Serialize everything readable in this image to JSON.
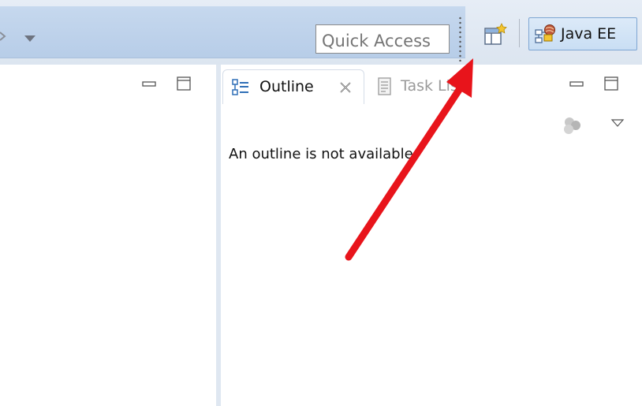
{
  "toolbar": {
    "quick_access_placeholder": "Quick Access",
    "perspective": {
      "label": "Java EE",
      "icon": "java-ee-perspective-icon"
    },
    "icons": {
      "open_perspective": "open-perspective-icon",
      "dropdown": "chevron-down-icon"
    }
  },
  "outline_view": {
    "tabs": [
      {
        "label": "Outline",
        "icon": "outline-icon",
        "active": true
      },
      {
        "label": "Task List",
        "icon": "task-list-icon",
        "active": false
      }
    ],
    "message": "An outline is not available."
  },
  "colors": {
    "toolbar_blue": "#b7cde8",
    "perspective_active": "#c9def4",
    "annotation_arrow": "#e8141b"
  }
}
